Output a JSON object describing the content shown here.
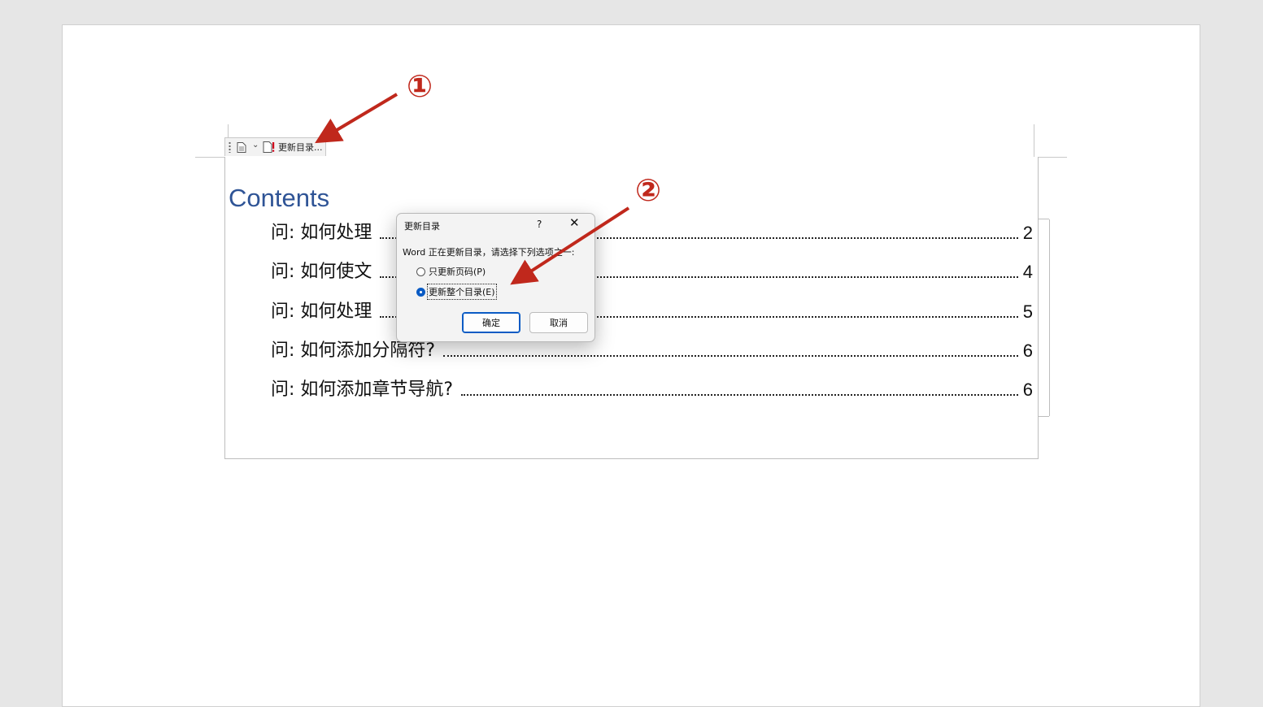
{
  "toc_tab": {
    "update_label": "更新目录..."
  },
  "toc": {
    "title": "Contents",
    "entries": [
      {
        "text": "问:  如何处理",
        "page": "2"
      },
      {
        "text": "问:  如何使文",
        "page": "4"
      },
      {
        "text": "问:  如何处理",
        "page": "5"
      },
      {
        "text": "问:  如何添加分隔符?",
        "page": "6"
      },
      {
        "text": "问:  如何添加章节导航?",
        "page": "6"
      }
    ]
  },
  "dialog": {
    "title": "更新目录",
    "help": "?",
    "close": "✕",
    "prompt": "Word 正在更新目录，请选择下列选项之一:",
    "options": [
      {
        "label": "只更新页码(P)",
        "selected": false
      },
      {
        "label": "更新整个目录(E)",
        "selected": true
      }
    ],
    "ok_label": "确定",
    "cancel_label": "取消"
  },
  "annotations": {
    "step1": "①",
    "step2": "②",
    "color": "#c0281c"
  }
}
